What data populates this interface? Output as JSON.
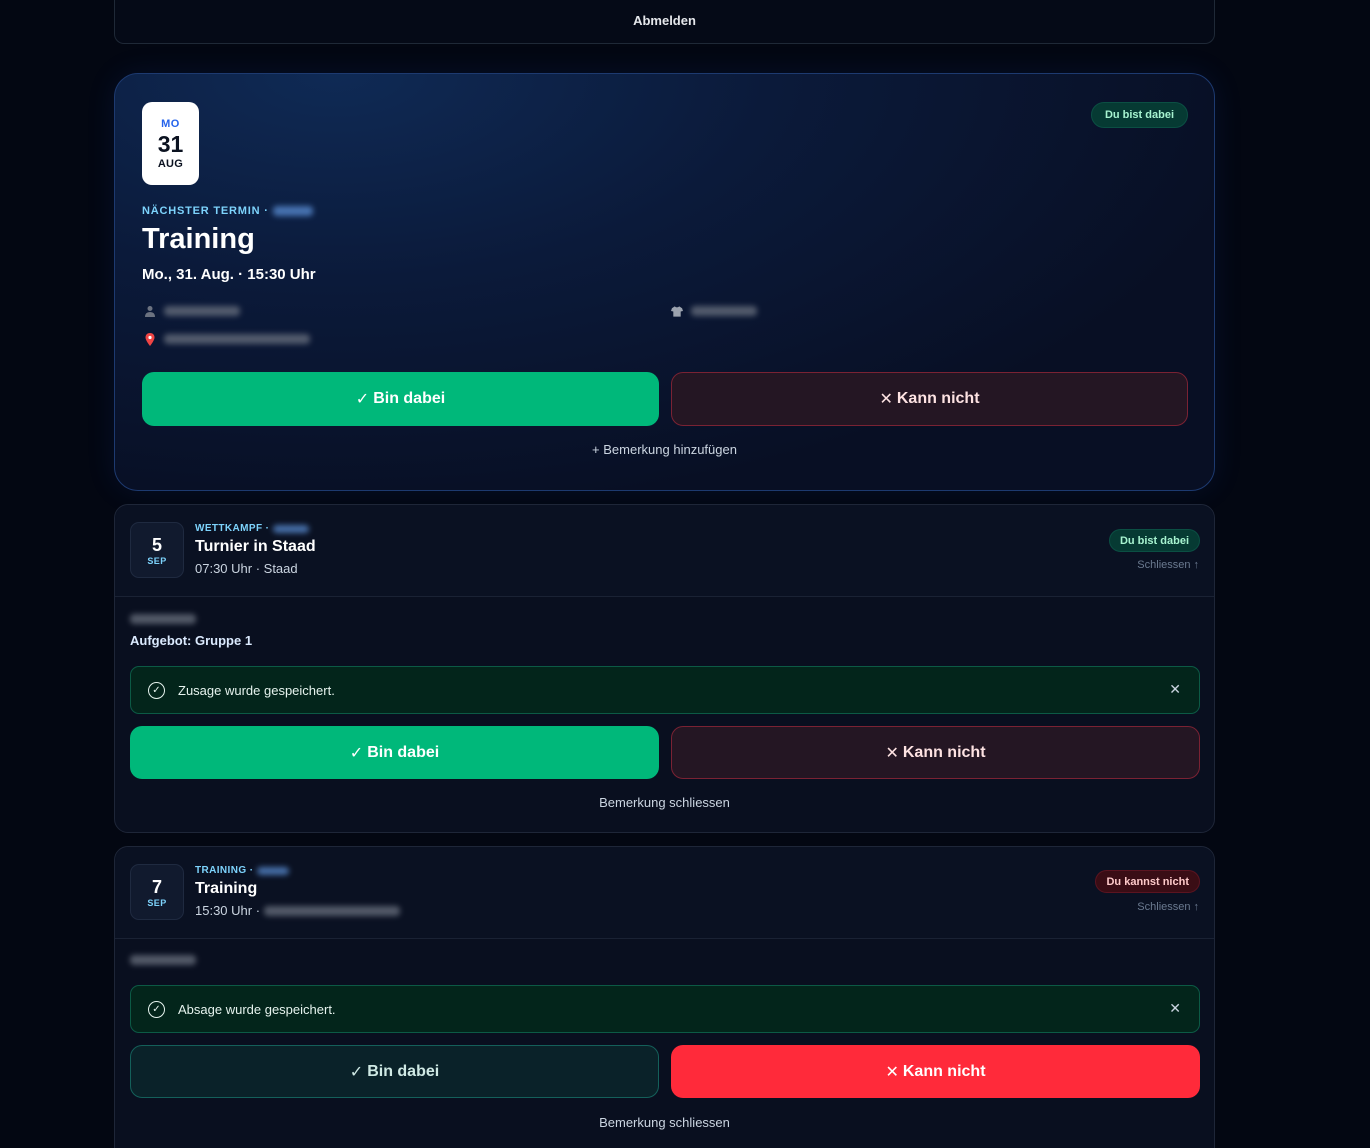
{
  "top": {
    "logout_label": "Abmelden"
  },
  "hero": {
    "date": {
      "dow": "MO",
      "day": "31",
      "month": "AUG"
    },
    "status": "Du bist dabei",
    "eyebrow": "NÄCHSTER TERMIN ·",
    "title": "Training",
    "when": "Mo., 31. Aug. · 15:30 Uhr",
    "yes_label": "Bin dabei",
    "no_label": "Kann nicht",
    "add_note": "+ Bemerkung hinzufügen",
    "icons": {
      "person": "person-icon",
      "location": "pin-icon",
      "shirt": "shirt-icon",
      "yes": "check-icon",
      "no": "x-icon"
    }
  },
  "events": [
    {
      "date": {
        "day": "5",
        "month": "SEP"
      },
      "eyebrow": "WETTKAMPF ·",
      "title": "Turnier in Staad",
      "sub": "07:30 Uhr · Staad",
      "status": "Du bist dabei",
      "collapse": "Schliessen",
      "aufgebot": "Aufgebot: Gruppe 1",
      "toast": "Zusage wurde gespeichert.",
      "yes_label": "Bin dabei",
      "no_label": "Kann nicht",
      "close_note": "Bemerkung schliessen"
    },
    {
      "date": {
        "day": "7",
        "month": "SEP"
      },
      "eyebrow": "TRAINING ·",
      "title": "Training",
      "sub": "15:30 Uhr ·",
      "status": "Du kannst nicht",
      "collapse": "Schliessen",
      "toast": "Absage wurde gespeichert.",
      "yes_label": "Bin dabei",
      "no_label": "Kann nicht",
      "close_note": "Bemerkung schliessen"
    }
  ],
  "colors": {
    "background": "#030712",
    "accept": "#00b87a",
    "decline": "#ff2a3a",
    "accent": "#7dd3fc"
  }
}
